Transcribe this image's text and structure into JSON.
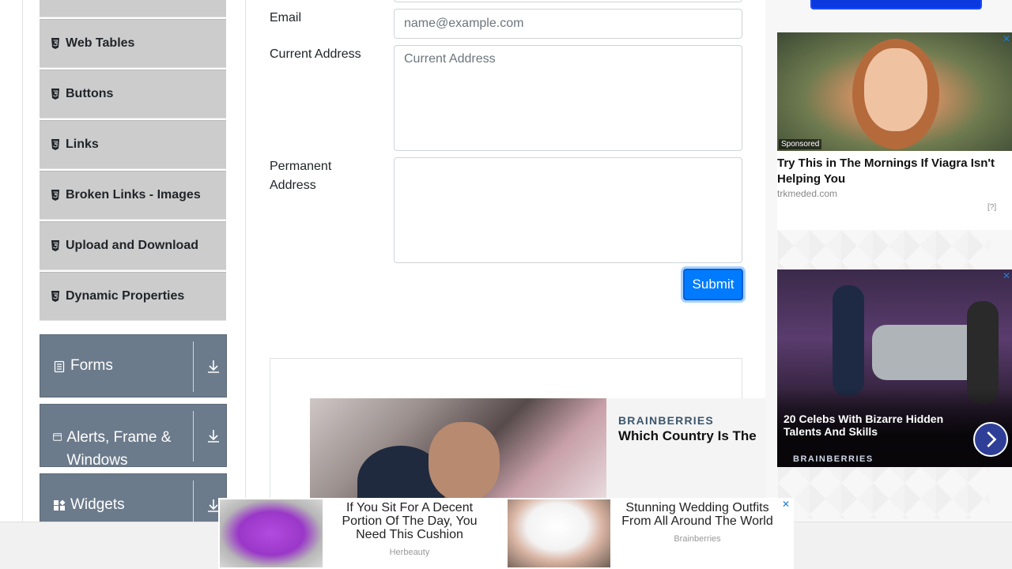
{
  "sidebar": {
    "elements_items": [
      {
        "label": "Web Tables"
      },
      {
        "label": "Buttons"
      },
      {
        "label": "Links"
      },
      {
        "label": "Broken Links - Images"
      },
      {
        "label": "Upload and Download"
      },
      {
        "label": "Dynamic Properties"
      }
    ],
    "groups": [
      {
        "label": "Forms",
        "icon": "document-icon"
      },
      {
        "label": "Alerts, Frame & Windows",
        "icon": "window-icon"
      },
      {
        "label": "Widgets",
        "icon": "widgets-icon"
      }
    ]
  },
  "form": {
    "email_label": "Email",
    "email_placeholder": "name@example.com",
    "current_address_label": "Current Address",
    "current_address_placeholder": "Current Address",
    "permanent_address_label": "Permanent Address",
    "submit_label": "Submit"
  },
  "ads": {
    "mid": {
      "brand": "BRAINBERRIES",
      "headline": "Which Country Is The"
    },
    "side1": {
      "sponsored": "Sponsored",
      "title": "Try This in The Mornings If Viagra Isn't Helping You",
      "source": "trkmeded.com",
      "info": "[?]"
    },
    "side2": {
      "title": "20 Celebs With Bizarre Hidden Talents And Skills",
      "brand": "BRAINBERRIES"
    },
    "bottom": {
      "item1_title": "If You Sit For A Decent Portion Of The Day, You Need This Cushion",
      "item1_source": "Herbeauty",
      "item2_title": "Stunning Wedding Outfits From All Around The World",
      "item2_source": "Brainberries"
    }
  },
  "colors": {
    "accent": "#007bff",
    "sidebar_item_bg": "#cccccc",
    "group_card_bg": "#6c7b8b"
  }
}
